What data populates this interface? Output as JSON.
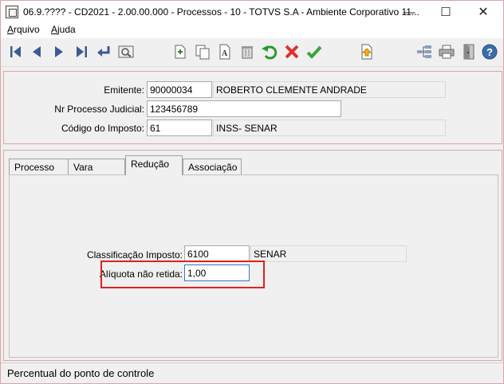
{
  "window": {
    "title": "06.9.???? - CD2021 - 2.00.00.000 - Processos - 10 - TOTVS S.A - Ambiente Corporativo 11...",
    "controls": {
      "minimize": "—",
      "maximize": "☐",
      "close": "✕"
    }
  },
  "menu": {
    "items": [
      {
        "mnemonic": "A",
        "rest": "rquivo"
      },
      {
        "mnemonic": "A",
        "rest": "juda"
      }
    ]
  },
  "toolbar": {
    "buttons": [
      "first-record-icon",
      "previous-record-icon",
      "next-record-icon",
      "last-record-icon",
      "goto-icon",
      "zoom-icon",
      "new-icon",
      "copy-icon",
      "edit-icon",
      "delete-icon",
      "undo-icon",
      "cancel-icon",
      "confirm-icon",
      "upload-icon",
      "tree-icon",
      "print-icon",
      "exit-icon",
      "help-icon"
    ],
    "colors": {
      "nav_blue": "#3b5b92",
      "undo_green": "#2a9a2a",
      "cancel_red": "#e03030",
      "confirm_green": "#3aa63a",
      "help_blue": "#3b6ea8"
    }
  },
  "header": {
    "emitente": {
      "label": "Emitente:",
      "value": "90000034",
      "description": "ROBERTO CLEMENTE ANDRADE"
    },
    "processo": {
      "label": "Nr Processo Judicial:",
      "value": "123456789"
    },
    "imposto": {
      "label": "Código do Imposto:",
      "value": "61",
      "description": "INSS- SENAR"
    }
  },
  "tabs": [
    {
      "label": "Processo"
    },
    {
      "label": "Vara"
    },
    {
      "label": "Redução",
      "active": true
    },
    {
      "label": "Associação"
    }
  ],
  "reducao": {
    "classificacao": {
      "label": "Classificação Imposto:",
      "value": "6100",
      "description": "SENAR"
    },
    "aliquota": {
      "label": "Alíquota não retida:",
      "value": "1,00"
    }
  },
  "status": {
    "text": "Percentual do ponto de controle"
  },
  "highlight_color": "#e02020"
}
